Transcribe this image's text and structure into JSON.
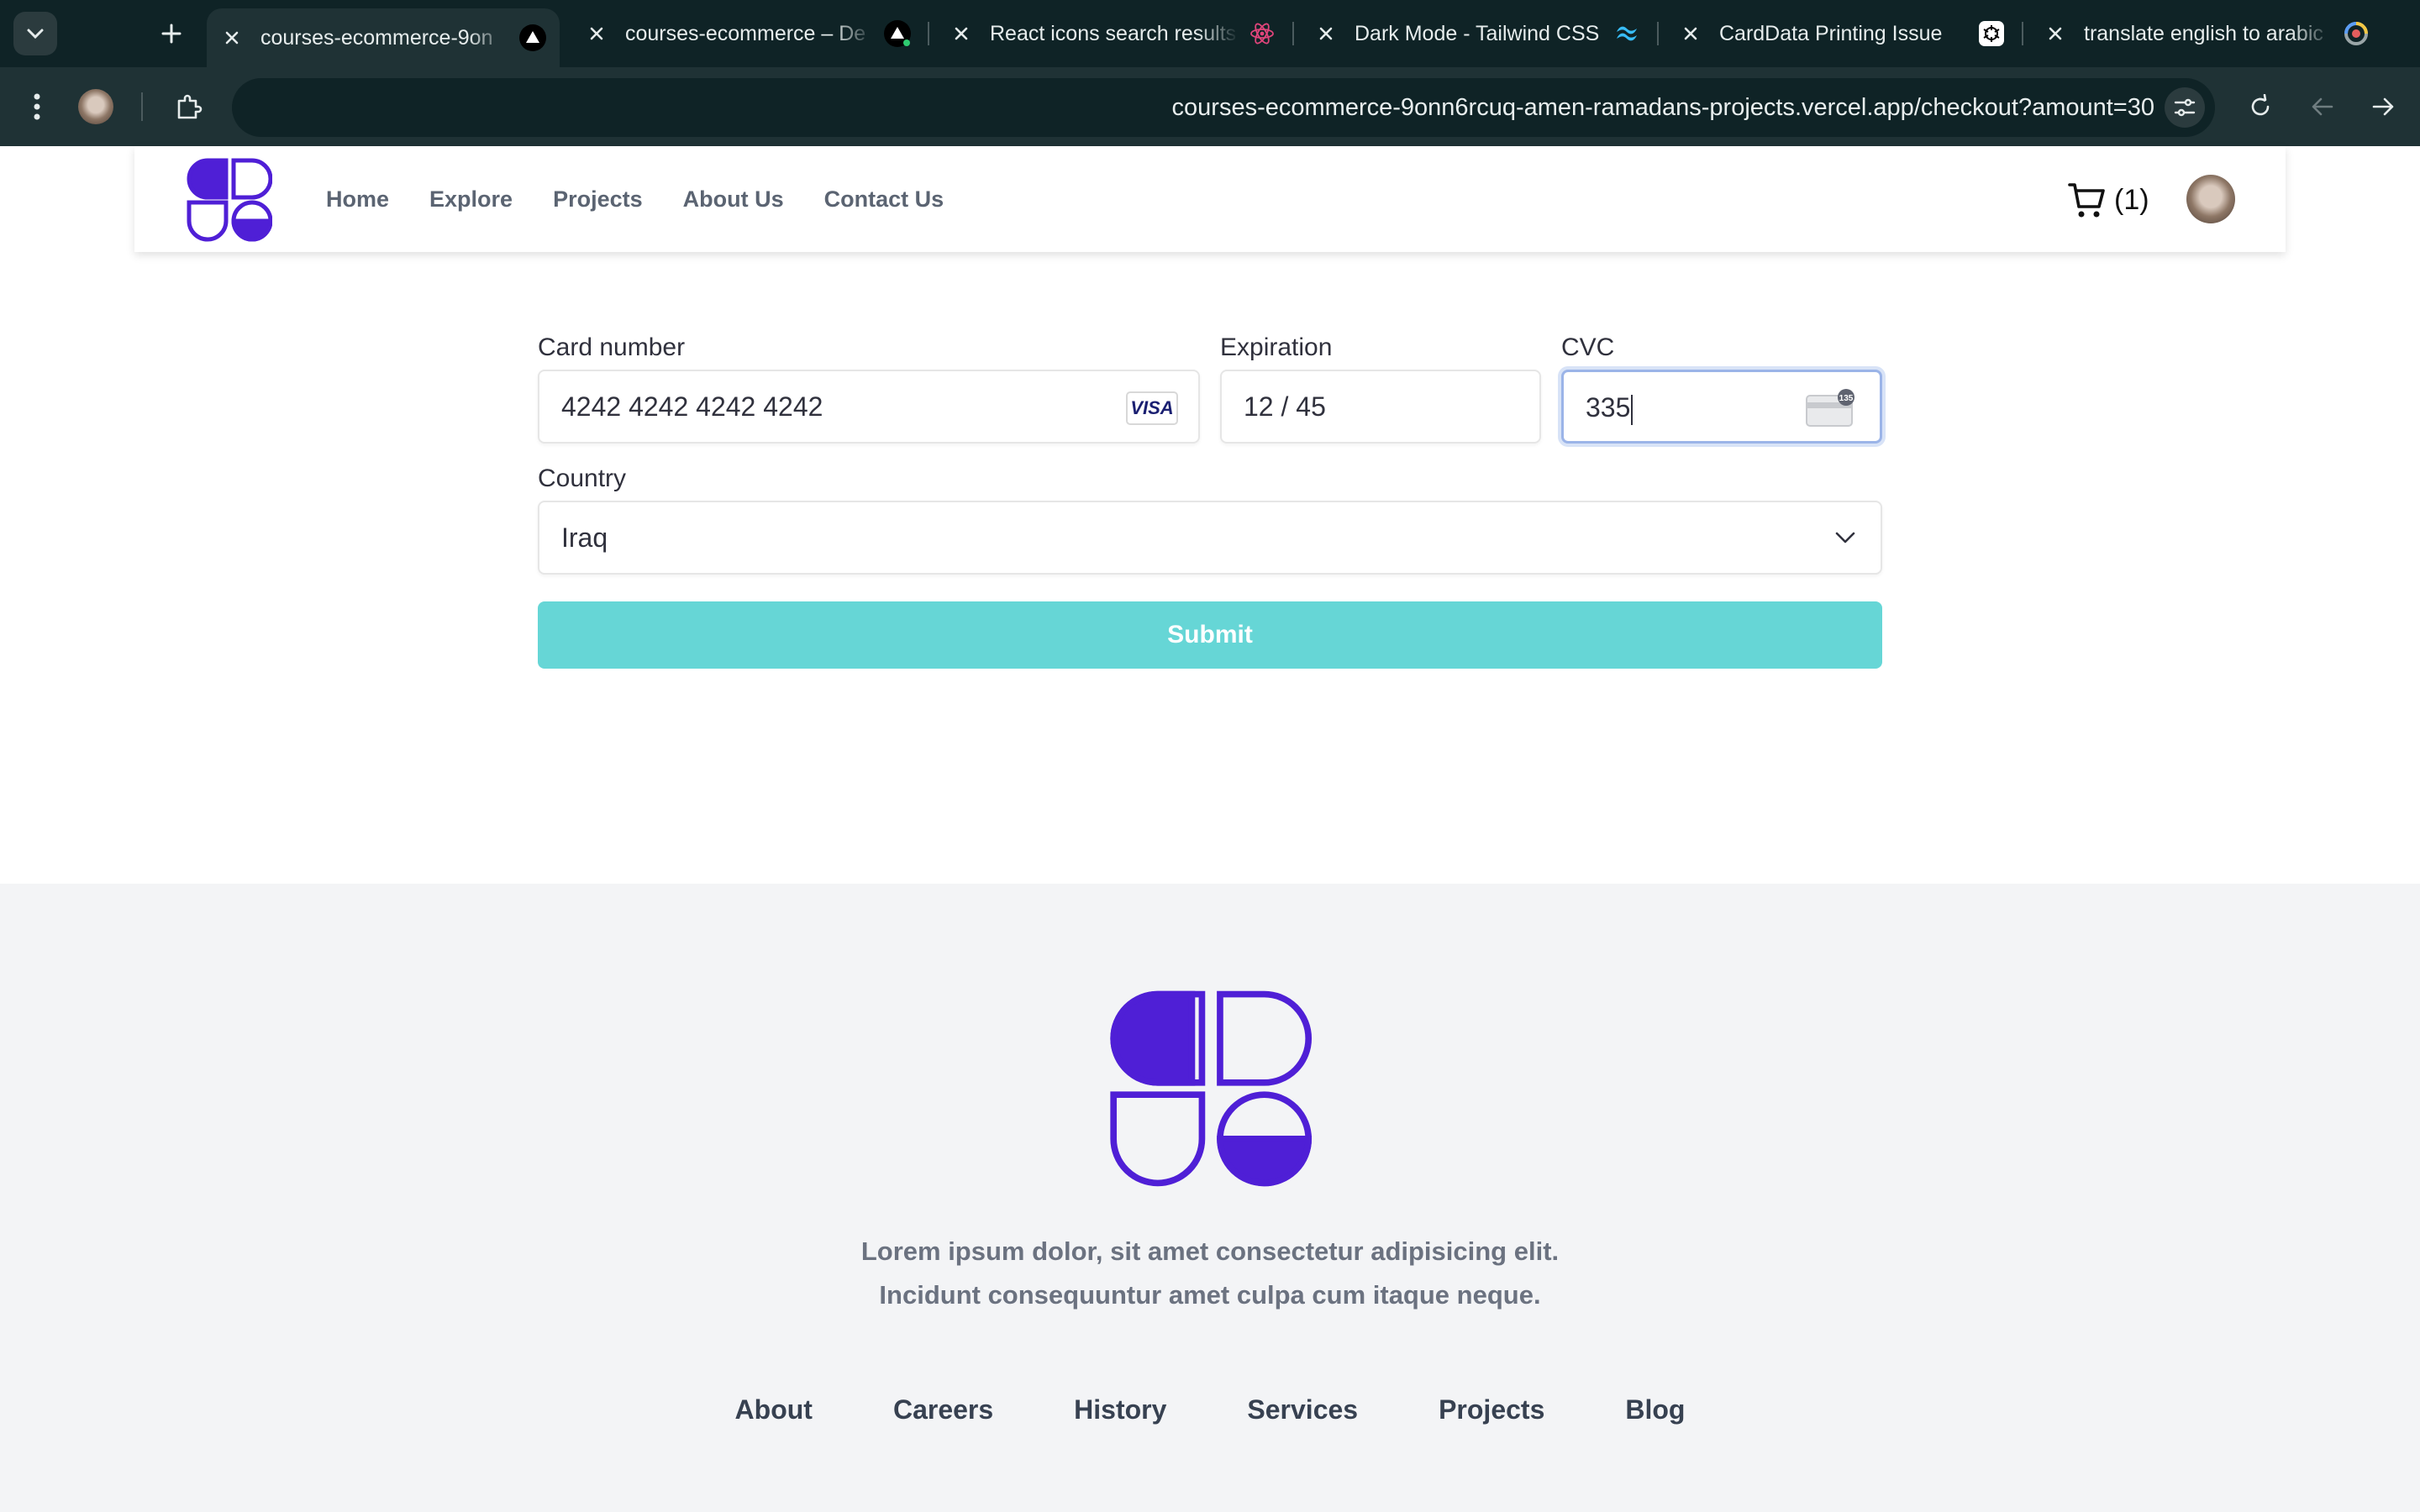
{
  "browser": {
    "tabs": [
      {
        "title": "courses-ecommerce-9on",
        "active": true,
        "favicon": "vercel-triangle-icon"
      },
      {
        "title": "courses-ecommerce – De",
        "active": false,
        "favicon": "vercel-triangle-icon"
      },
      {
        "title": "React icons search results",
        "active": false,
        "favicon": "react-icon"
      },
      {
        "title": "Dark Mode - Tailwind CSS",
        "active": false,
        "favicon": "tailwind-icon"
      },
      {
        "title": "CardData Printing Issue",
        "active": false,
        "favicon": "openai-icon"
      },
      {
        "title": "translate english to arabic",
        "active": false,
        "favicon": "google-lens-icon"
      }
    ],
    "url": "courses-ecommerce-9onn6rcuq-amen-ramadans-projects.vercel.app/checkout?amount=30"
  },
  "header": {
    "nav": [
      "Home",
      "Explore",
      "Projects",
      "About Us",
      "Contact Us"
    ],
    "cart_count": "(1)"
  },
  "checkout": {
    "card_number_label": "Card number",
    "card_number_value": "4242 4242 4242 4242",
    "card_brand": "VISA",
    "expiration_label": "Expiration",
    "expiration_value": "12 / 45",
    "cvc_label": "CVC",
    "cvc_value": "335",
    "cvc_icon_text": "135",
    "country_label": "Country",
    "country_value": "Iraq",
    "submit_label": "Submit"
  },
  "footer": {
    "text_line1": "Lorem ipsum dolor, sit amet consectetur adipisicing elit.",
    "text_line2": "Incidunt consequuntur amet culpa cum itaque neque.",
    "links": [
      "About",
      "Careers",
      "History",
      "Services",
      "Projects",
      "Blog"
    ]
  },
  "colors": {
    "brand": "#4f1fd6",
    "submit": "#66d6d6",
    "chrome_dark": "#0f2326",
    "chrome_toolbar": "#1f3235"
  }
}
